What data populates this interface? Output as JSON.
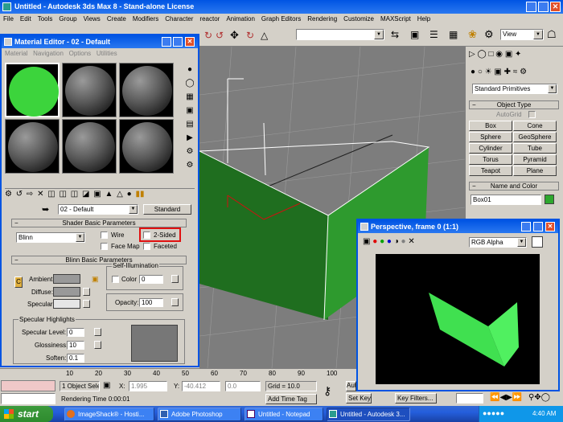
{
  "app": {
    "title": "Untitled - Autodesk 3ds Max 8  - Stand-alone License"
  },
  "menu": [
    "File",
    "Edit",
    "Tools",
    "Group",
    "Views",
    "Create",
    "Modifiers",
    "Character",
    "reactor",
    "Animation",
    "Graph Editors",
    "Rendering",
    "Customize",
    "MAXScript",
    "Help"
  ],
  "toolbar": {
    "view_select": "View"
  },
  "material_editor": {
    "title": "Material Editor - 02 - Default",
    "menu": [
      "Material",
      "Navigation",
      "Options",
      "Utilities"
    ],
    "material_name": "02 - Default",
    "material_type": "Standard",
    "shader_rollout": "Shader Basic Parameters",
    "shader": "Blinn",
    "wire": "Wire",
    "two_sided": "2-Sided",
    "face_map": "Face Map",
    "faceted": "Faceted",
    "blinn_rollout": "Blinn Basic Parameters",
    "self_illum": "Self-Illumination",
    "color_label": "Color",
    "color_value": "0",
    "ambient": "Ambient:",
    "diffuse": "Diffuse:",
    "specular": "Specular:",
    "opacity_label": "Opacity:",
    "opacity_value": "100",
    "spec_highlights": "Specular Highlights",
    "spec_level_label": "Specular Level:",
    "spec_level": "0",
    "glossiness_label": "Glossiness:",
    "glossiness": "10",
    "soften_label": "Soften:",
    "soften": "0.1",
    "c_label": "C"
  },
  "command_panel": {
    "dropdown": "Standard Primitives",
    "object_type": "Object Type",
    "autogrid": "AutoGrid",
    "buttons": [
      "Box",
      "Cone",
      "Sphere",
      "GeoSphere",
      "Cylinder",
      "Tube",
      "Torus",
      "Pyramid",
      "Teapot",
      "Plane"
    ],
    "name_color": "Name and Color",
    "object_name": "Box01"
  },
  "render_window": {
    "title": "Perspective, frame 0 (1:1)",
    "channel": "RGB Alpha"
  },
  "status": {
    "timeline_ticks": [
      "10",
      "20",
      "30",
      "40",
      "50",
      "60",
      "70",
      "80",
      "90",
      "100"
    ],
    "selected": "1 Object Sele",
    "x_label": "X:",
    "x_value": "1.995",
    "y_label": "Y:",
    "y_value": "-40.412",
    "z_value": "0.0",
    "grid": "Grid = 10.0",
    "render_time": "Rendering Time  0:00:01",
    "add_time_tag": "Add Time Tag",
    "auto": "Auto",
    "set_key": "Set Key",
    "key_filters": "Key Filters..."
  },
  "taskbar": {
    "start": "start",
    "tasks": [
      "ImageShack® - Hosti...",
      "Adobe Photoshop",
      "Untitled - Notepad",
      "Untitled - Autodesk 3..."
    ],
    "clock": "4:40 AM"
  },
  "colors": {
    "green": "#3cd43c",
    "object_green": "#2e8b2e",
    "highlight_red": "#e01010",
    "title_blue": "#0a246a"
  }
}
